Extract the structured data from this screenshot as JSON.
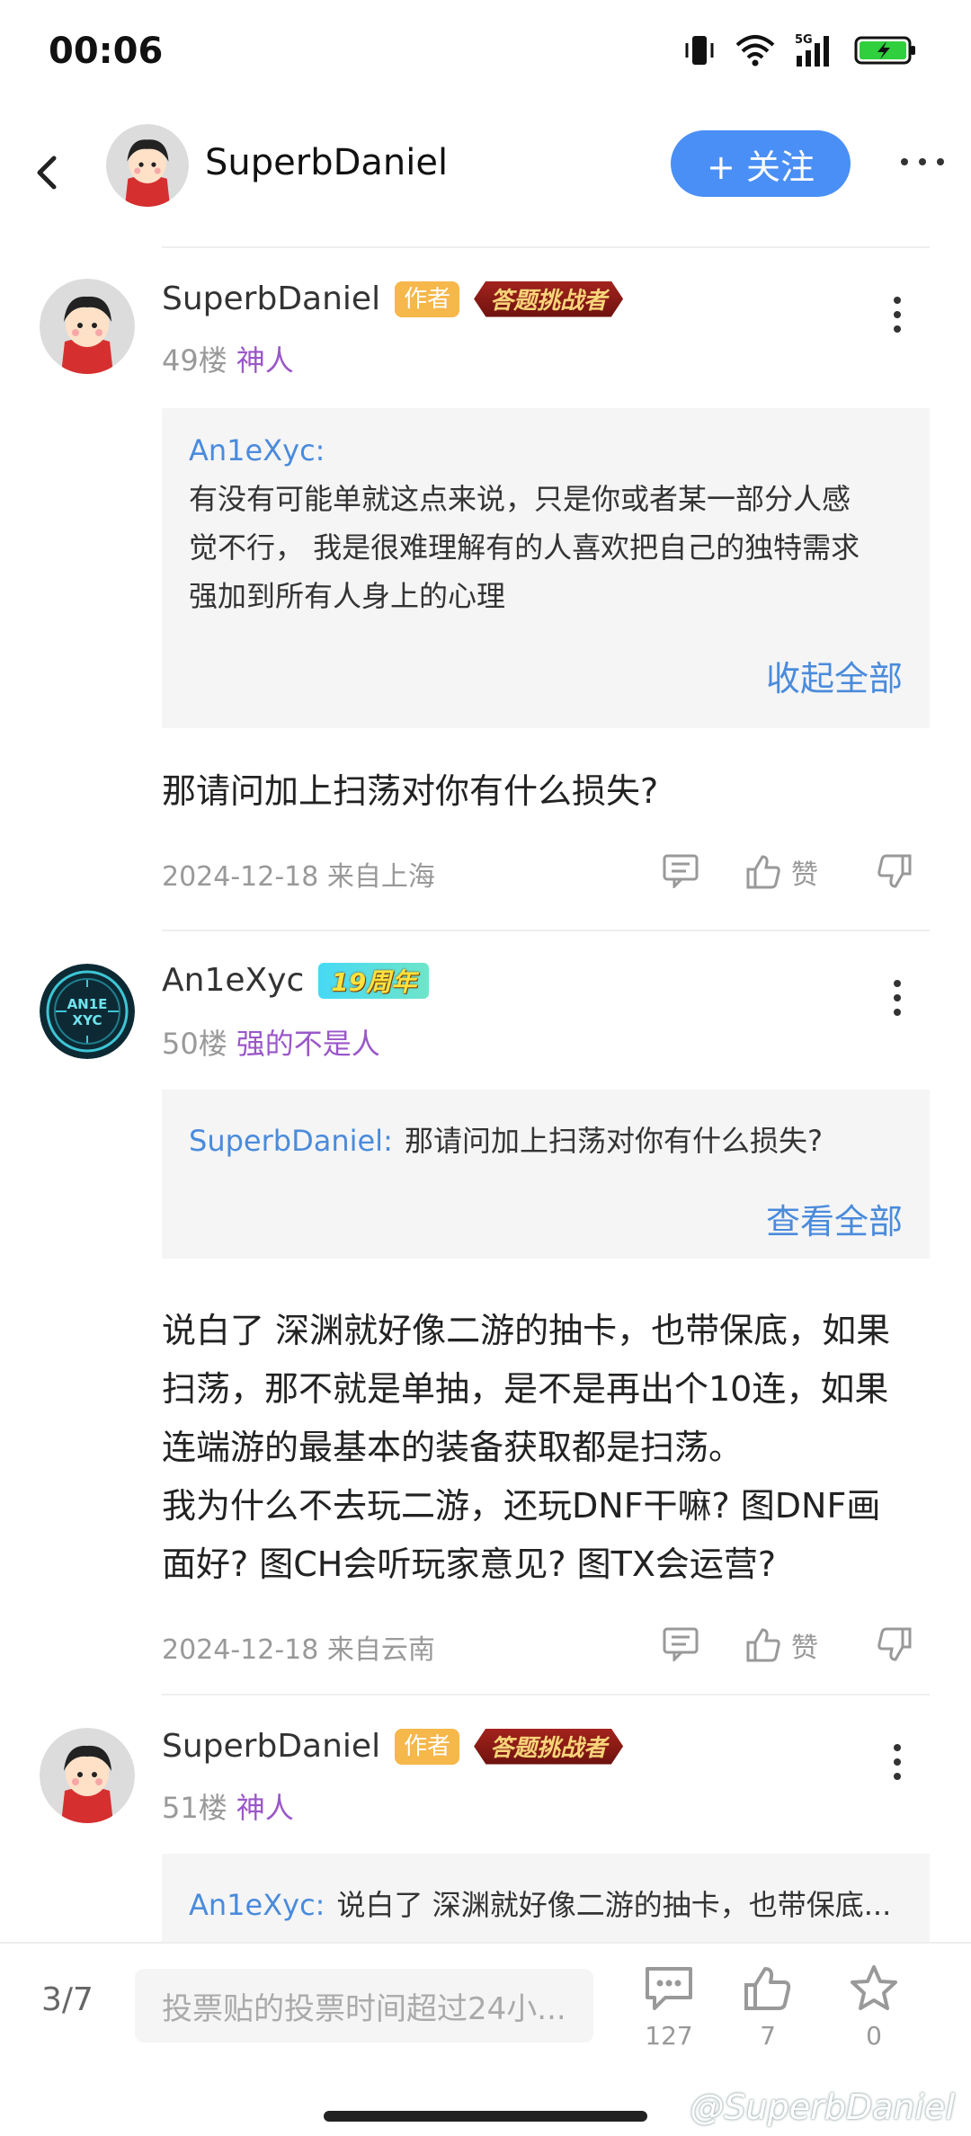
{
  "status": {
    "time": "00:06",
    "network": "5G"
  },
  "header": {
    "username": "SuperbDaniel",
    "follow_label": "+ 关注"
  },
  "posts": [
    {
      "username": "SuperbDaniel",
      "author_tag": "作者",
      "badge": "答题挑战者",
      "floor": "49楼",
      "level": "神人",
      "quote": {
        "user": "An1eXyc:",
        "lines": [
          "有没有可能单就这点来说，只是你或者某一部分人感",
          "觉不行， 我是很难理解有的人喜欢把自己的独特需求",
          "强加到所有人身上的心理"
        ],
        "toggle": "收起全部"
      },
      "content": "那请问加上扫荡对你有什么损失?",
      "date": "2024-12-18 来自上海",
      "like_label": "赞"
    },
    {
      "username": "An1eXyc",
      "badge": "19周年",
      "floor": "50楼",
      "level": "强的不是人",
      "quote": {
        "user": "SuperbDaniel:",
        "text": "那请问加上扫荡对你有什么损失?",
        "toggle": "查看全部"
      },
      "content_lines": [
        "说白了 深渊就好像二游的抽卡，也带保底，如果",
        "扫荡，那不就是单抽，是不是再出个10连，如果",
        "连端游的最基本的装备获取都是扫荡。",
        "我为什么不去玩二游，还玩DNF干嘛? 图DNF画",
        "面好? 图CH会听玩家意见? 图TX会运营?"
      ],
      "date": "2024-12-18 来自云南",
      "like_label": "赞"
    },
    {
      "username": "SuperbDaniel",
      "author_tag": "作者",
      "badge": "答题挑战者",
      "floor": "51楼",
      "level": "神人",
      "quote": {
        "user": "An1eXyc:",
        "text": "说白了 深渊就好像二游的抽卡，也带保底..."
      }
    }
  ],
  "bottom_bar": {
    "page": "3/7",
    "input_placeholder": "投票贴的投票时间超过24小...",
    "comments": "127",
    "likes": "7",
    "favorites": "0",
    "watermark": "@SuperbDaniel"
  },
  "colors": {
    "accent": "#4a8ff5",
    "link": "#4a8bdc",
    "level": "#9a57c9",
    "author_tag": "#f6b74b"
  }
}
